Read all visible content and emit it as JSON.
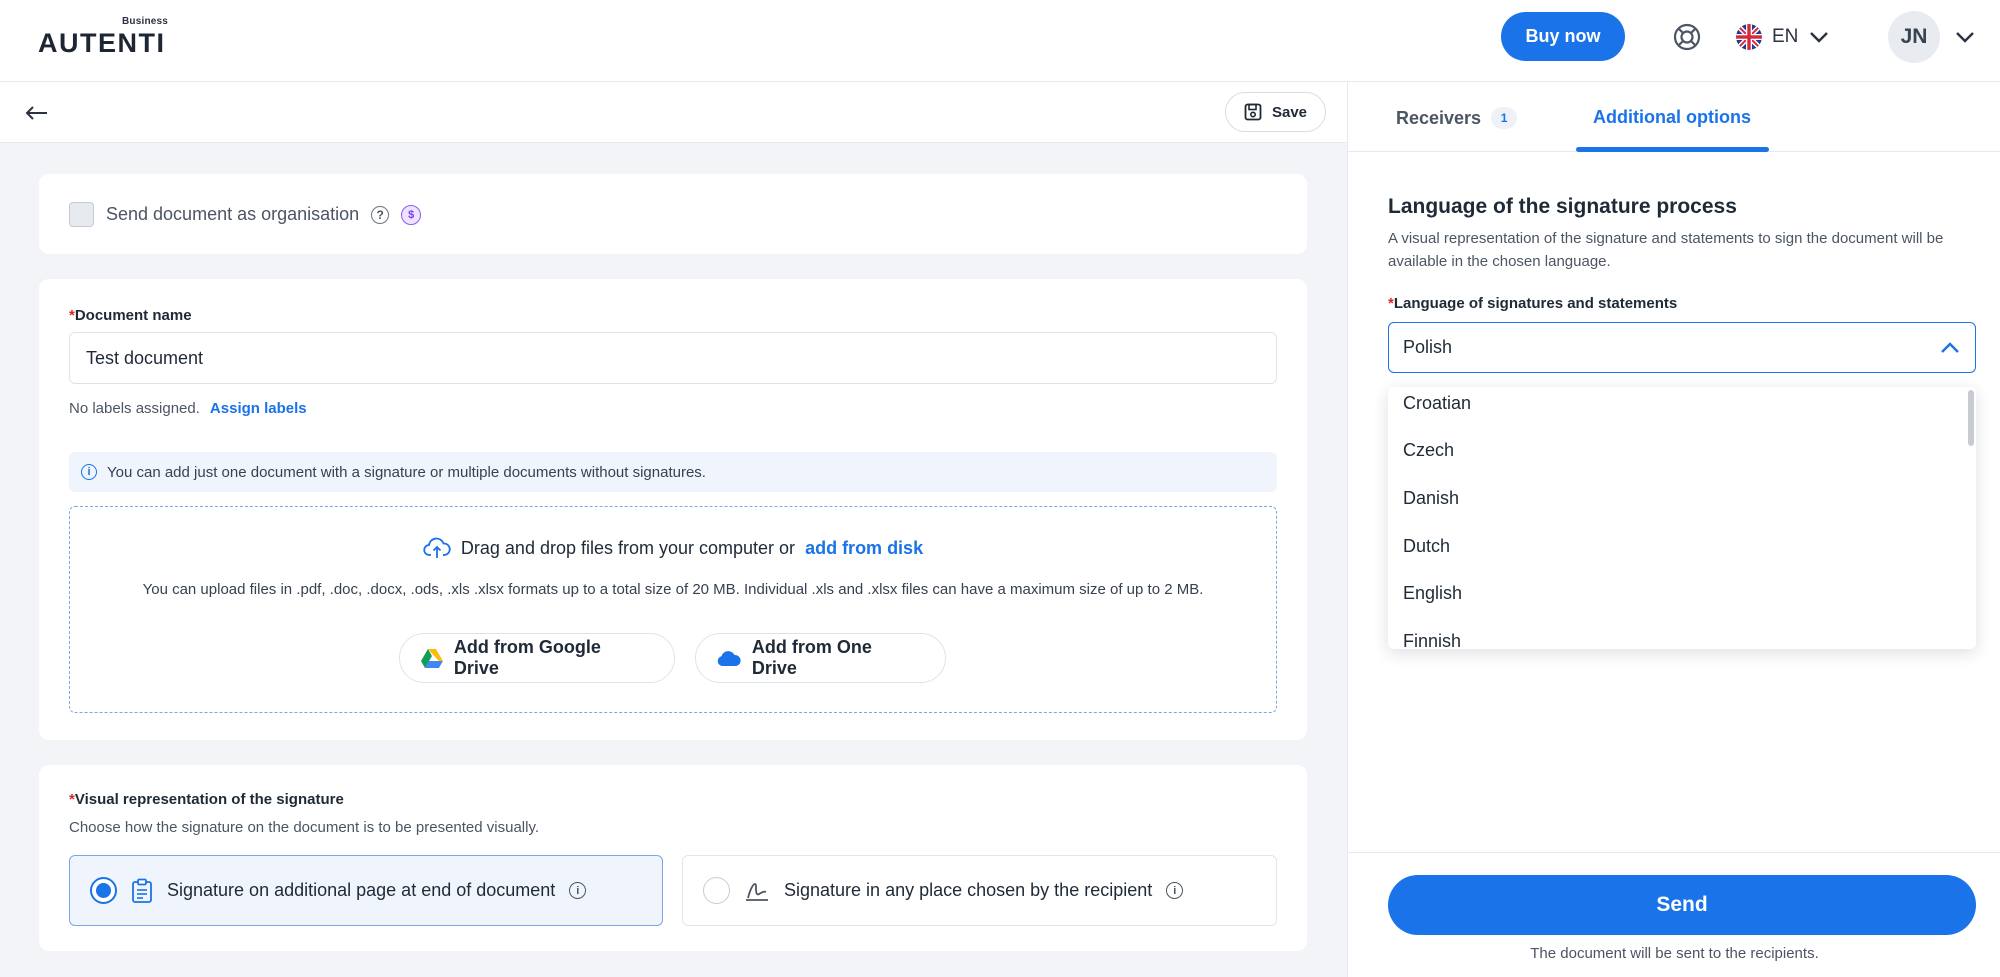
{
  "header": {
    "logo_text": "AUTENTI",
    "logo_subtitle": "Business",
    "buy_now_label": "Buy now",
    "language_code": "EN",
    "user_initials": "JN"
  },
  "toolbar": {
    "save_label": "Save"
  },
  "organisation": {
    "label": "Send document as organisation",
    "checked": false
  },
  "document": {
    "name_label": "Document name",
    "name_value": "Test document",
    "labels_none": "No labels assigned.",
    "assign_labels": "Assign labels",
    "info_text": "You can add just one document with a signature or multiple documents without signatures.",
    "dropzone_text": "Drag and drop files from your computer or",
    "dropzone_link": "add from disk",
    "dropzone_sub": "You can upload files in .pdf, .doc, .docx, .ods, .xls .xlsx formats up to a total size of 20 MB. Individual .xls and .xlsx files can have a maximum size of up to 2 MB.",
    "google_drive_label": "Add from Google Drive",
    "one_drive_label": "Add from One Drive"
  },
  "visual": {
    "label": "Visual representation of the signature",
    "description": "Choose how the signature on the document is to be presented visually.",
    "options": [
      {
        "label": "Signature on additional page at end of document",
        "selected": true
      },
      {
        "label": "Signature in any place chosen by the recipient",
        "selected": false
      }
    ]
  },
  "tabs": {
    "receivers_label": "Receivers",
    "receivers_count": "1",
    "options_label": "Additional options",
    "active": "Additional options"
  },
  "language_section": {
    "title": "Language of the signature process",
    "description": "A visual representation of the signature and statements to sign the document will be available in the chosen language.",
    "field_label": "Language of signatures and statements",
    "selected": "Polish",
    "options": [
      "Croatian",
      "Czech",
      "Danish",
      "Dutch",
      "English",
      "Finnish"
    ]
  },
  "send": {
    "label": "Send",
    "note": "The document will be sent to the recipients."
  },
  "colors": {
    "accent": "#1a73e8",
    "required": "#dc2626",
    "panel_bg": "#f2f4f7"
  }
}
